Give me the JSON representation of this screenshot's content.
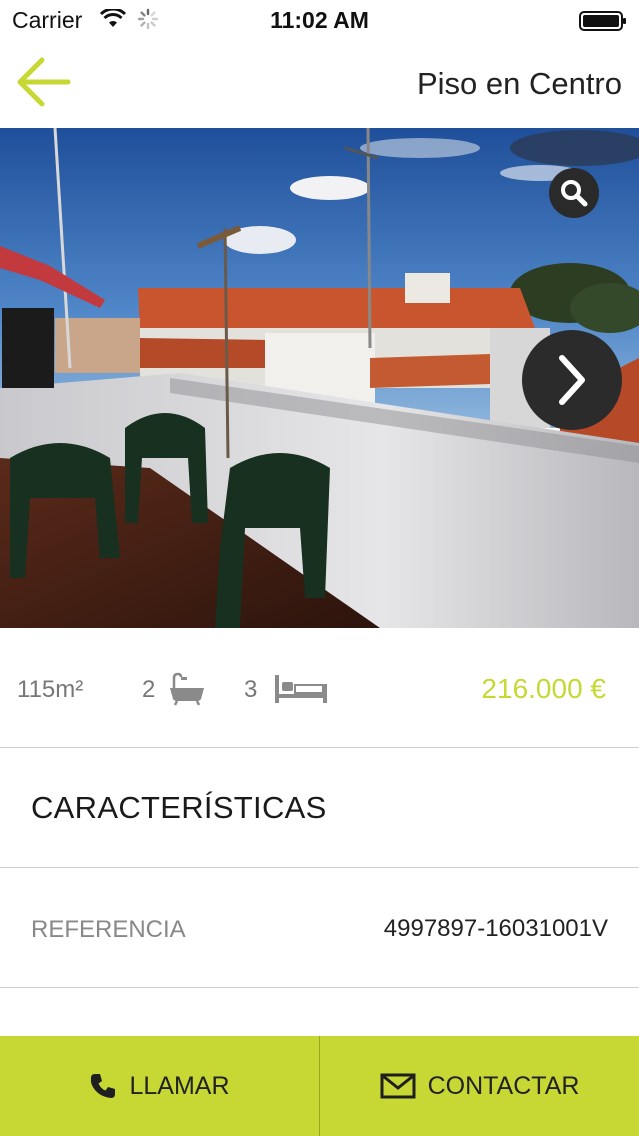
{
  "status_bar": {
    "carrier": "Carrier",
    "time": "11:02 AM"
  },
  "nav": {
    "title": "Piso en Centro",
    "back_icon": "arrow-left-icon",
    "accent_color": "#c7d835"
  },
  "photo": {
    "zoom_icon": "magnifier-icon",
    "next_icon": "chevron-right-icon"
  },
  "stats": {
    "area": "115m²",
    "baths": "2",
    "beds": "3",
    "price": "216.000 €",
    "price_color": "#c7d835"
  },
  "section": {
    "title": "CARACTERÍSTICAS"
  },
  "reference": {
    "label": "REFERENCIA",
    "value": "4997897-16031001V"
  },
  "actions": {
    "call_label": "LLAMAR",
    "contact_label": "CONTACTAR",
    "bar_color": "#c7d835"
  }
}
